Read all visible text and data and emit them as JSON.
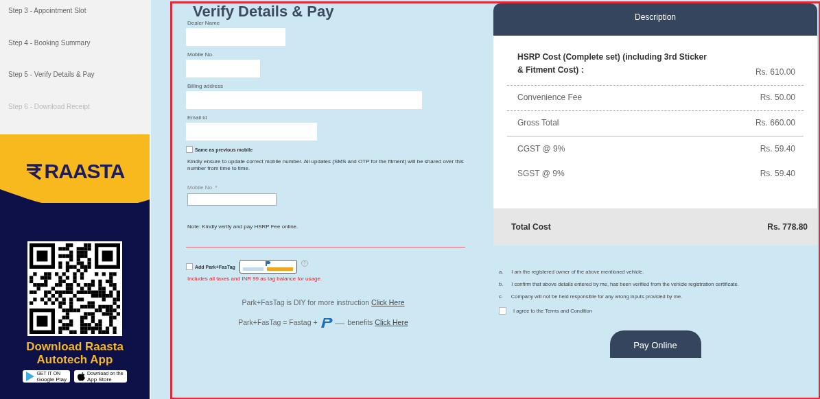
{
  "sidebar": {
    "steps": [
      {
        "label": "Step 3 - Appointment Slot",
        "disabled": false
      },
      {
        "label": "Step 4 - Booking Summary",
        "disabled": false
      },
      {
        "label": "Step 5 - Verify Details & Pay",
        "disabled": false
      },
      {
        "label": "Step 6 - Download Receipt",
        "disabled": true
      }
    ]
  },
  "promo": {
    "brand": "RAASTA",
    "headline": "Download Raasta Autotech App",
    "badges": [
      {
        "kind": "play",
        "small": "GET IT ON",
        "big": "Google Play"
      },
      {
        "kind": "apple",
        "small": "Download on the",
        "big": "App Store"
      }
    ]
  },
  "form": {
    "title": "Verify Details & Pay",
    "fields": [
      {
        "label": "Dealer Name"
      },
      {
        "label": "Mobile No."
      },
      {
        "label": "Billing address"
      },
      {
        "label": "Email id"
      }
    ],
    "same_as_previous": {
      "label": "Same as previous mobile",
      "checked": false
    },
    "mobile_note": "Kindly ensure to update correct mobile number. All updates (SMS and OTP for the fitment) will be shared over this number from time to time.",
    "mobile_field": {
      "label": "Mobile No. *"
    },
    "fee_note": "Note: Kindly verify and pay HSRP Fee online.",
    "fastag": {
      "label": "Add Park+FasTag",
      "checked": false,
      "info": "?",
      "warning": "Includes all taxes and INR 99 as tag balance for usage."
    },
    "diy_line": {
      "text": "Park+FasTag is DIY for more instruction",
      "link": "Click Here"
    },
    "benefit_line": {
      "text": "Park+FasTag = Fastag +",
      "after": "benefits",
      "link": "Click Here"
    }
  },
  "costs": {
    "header": "Description",
    "rows": [
      {
        "label": "HSRP Cost (Complete set) (including 3rd Sticker & Fitment Cost) :",
        "amount": "Rs. 610.00",
        "bold": true,
        "kind": "dashed"
      },
      {
        "label": "Convenience Fee",
        "amount": "Rs. 50.00",
        "bold": false,
        "kind": "dashed"
      },
      {
        "label": "Gross Total",
        "amount": "Rs. 660.00",
        "bold": false,
        "kind": "solid"
      },
      {
        "label": "CGST @ 9%",
        "amount": "Rs. 59.40",
        "bold": false,
        "kind": "plain"
      },
      {
        "label": "SGST @ 9%",
        "amount": "Rs. 59.40",
        "bold": false,
        "kind": "plain"
      }
    ],
    "total": {
      "label": "Total Cost",
      "amount": "Rs. 778.80"
    }
  },
  "terms": {
    "items": [
      {
        "marker": "a.",
        "text": "I am the registered owner of the above mentioned vehicle."
      },
      {
        "marker": "b.",
        "text": "I confirm that above details entered by me, has been verified from the vehicle registration certificate."
      },
      {
        "marker": "c.",
        "text": "Company will not be held responsible for any wrong inputs provided by me."
      }
    ],
    "agree": {
      "label": "I agree to the Terms and Condition",
      "checked": false
    },
    "button": "Pay Online"
  }
}
